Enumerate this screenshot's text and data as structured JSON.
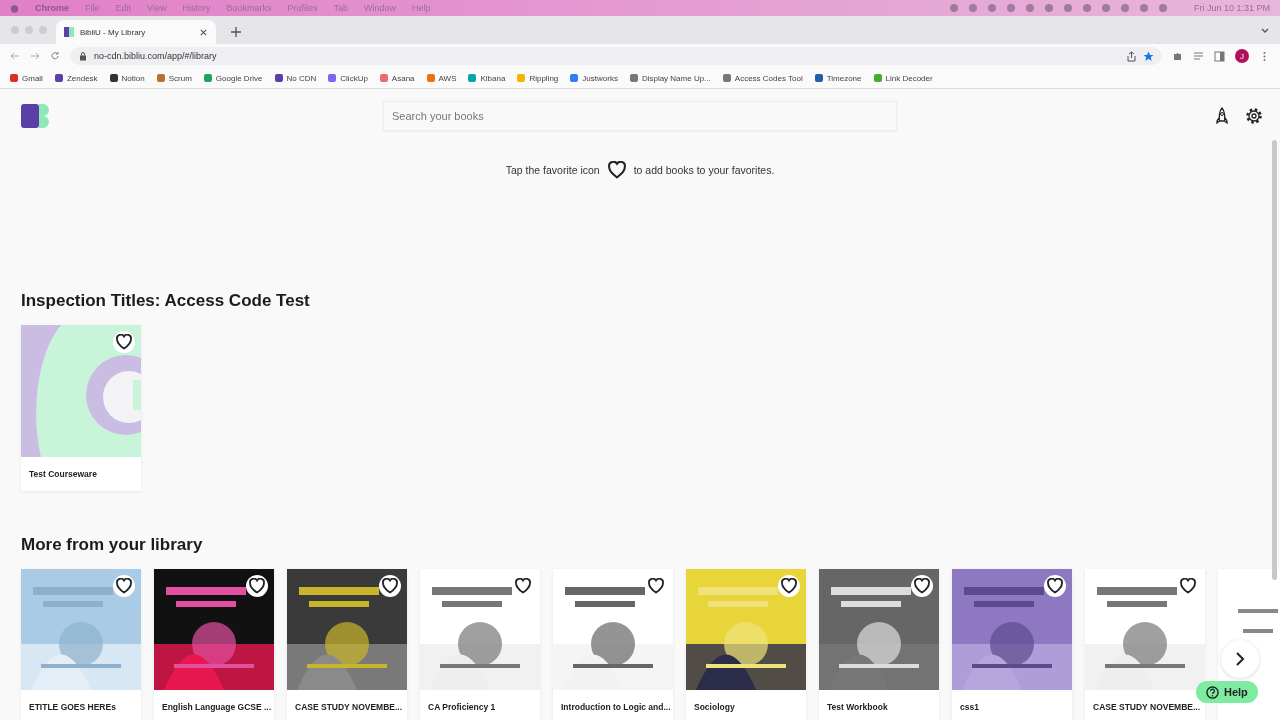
{
  "menu_bar": {
    "items": [
      "Chrome",
      "File",
      "Edit",
      "View",
      "History",
      "Bookmarks",
      "Profiles",
      "Tab",
      "Window",
      "Help"
    ],
    "clock": "Fri Jun 10  1:31 PM"
  },
  "browser": {
    "tab": {
      "title": "BibliU - My Library",
      "selected": true
    },
    "url": "no-cdn.bibliu.com/app/#/library",
    "avatar": "J",
    "bookmarks": [
      {
        "label": "Gmail",
        "color": "#d93025"
      },
      {
        "label": "Zendesk",
        "color": "#5b3fa6"
      },
      {
        "label": "Notion",
        "color": "#333333"
      },
      {
        "label": "Scrum",
        "color": "#b8732a"
      },
      {
        "label": "Google Drive",
        "color": "#1fa463"
      },
      {
        "label": "No CDN",
        "color": "#5b3fa6"
      },
      {
        "label": "ClickUp",
        "color": "#7b68ee"
      },
      {
        "label": "Asana",
        "color": "#f06a6a"
      },
      {
        "label": "AWS",
        "color": "#ec7211"
      },
      {
        "label": "Kibana",
        "color": "#00a9a5"
      },
      {
        "label": "Rippling",
        "color": "#f5b400"
      },
      {
        "label": "Justworks",
        "color": "#2f80ed"
      },
      {
        "label": "Display Name Up...",
        "color": "#777777"
      },
      {
        "label": "Access Codes Tool",
        "color": "#777777"
      },
      {
        "label": "Timezone",
        "color": "#1d5fa8"
      },
      {
        "label": "Link Decoder",
        "color": "#3fae29"
      }
    ]
  },
  "app": {
    "search": {
      "placeholder": "Search your books"
    },
    "favorites_hint": {
      "before": "Tap the favorite icon",
      "after": "to add books to your favorites."
    },
    "sections": [
      {
        "title": "Inspection Titles: Access Code Test",
        "books": [
          {
            "title": "Test Courseware",
            "favorited": false
          }
        ]
      },
      {
        "title": "More from your library",
        "books": [
          {
            "title": "ETITLE GOES HEREs",
            "favorited": false
          },
          {
            "title": "English Language GCSE ...",
            "favorited": false
          },
          {
            "title": "CASE STUDY NOVEMBE...",
            "favorited": false
          },
          {
            "title": "CA Proficiency 1",
            "favorited": false
          },
          {
            "title": "Introduction to Logic and...",
            "favorited": false
          },
          {
            "title": "Sociology",
            "favorited": false
          },
          {
            "title": "Test Workbook",
            "favorited": false
          },
          {
            "title": "css1",
            "favorited": false
          },
          {
            "title": "CASE STUDY NOVEMBE...",
            "favorited": false
          }
        ]
      }
    ],
    "help_button": "Help"
  }
}
